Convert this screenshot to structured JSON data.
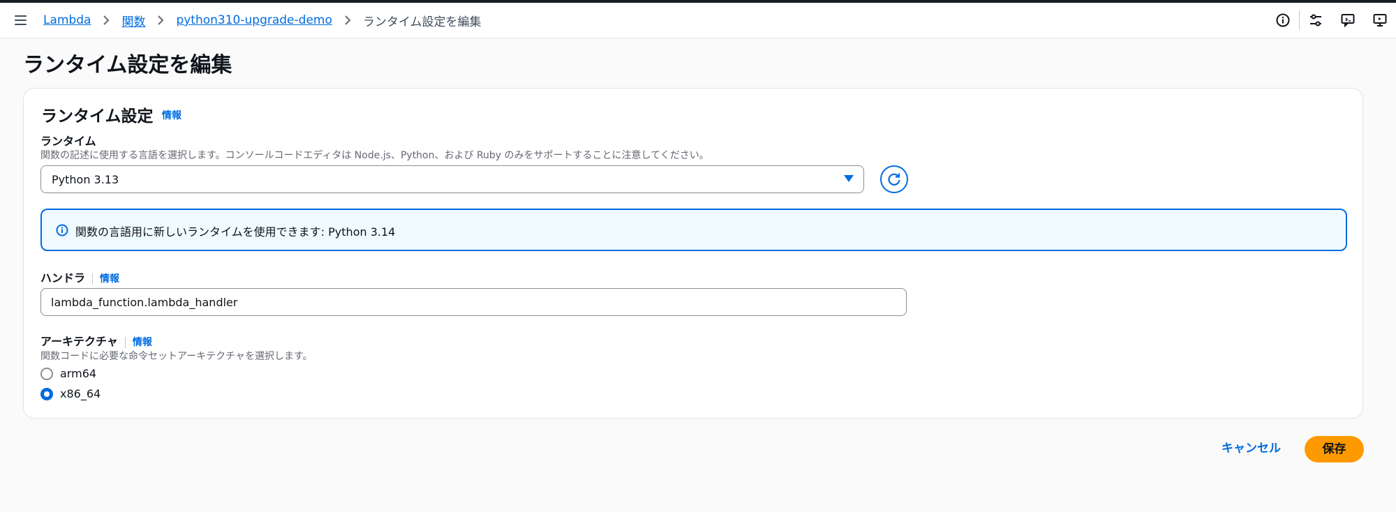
{
  "breadcrumb": {
    "items": [
      "Lambda",
      "関数",
      "python310-upgrade-demo"
    ],
    "current": "ランタイム設定を編集"
  },
  "header": {
    "icons": [
      "info-icon",
      "settings-sliders-icon",
      "feedback-icon",
      "screen-share-icon"
    ]
  },
  "page": {
    "title": "ランタイム設定を編集"
  },
  "card": {
    "title": "ランタイム設定",
    "info": "情報"
  },
  "runtime": {
    "label": "ランタイム",
    "description": "関数の記述に使用する言語を選択します。コンソールコードエディタは Node.js、Python、および Ruby のみをサポートすることに注意してください。",
    "selected": "Python 3.13"
  },
  "alert": {
    "text": "関数の言語用に新しいランタイムを使用できます: Python 3.14"
  },
  "handler": {
    "label": "ハンドラ",
    "info": "情報",
    "value": "lambda_function.lambda_handler"
  },
  "architecture": {
    "label": "アーキテクチャ",
    "info": "情報",
    "description": "関数コードに必要な命令セットアーキテクチャを選択します。",
    "options": [
      {
        "label": "arm64",
        "checked": false
      },
      {
        "label": "x86_64",
        "checked": true
      }
    ]
  },
  "actions": {
    "cancel": "キャンセル",
    "save": "保存"
  },
  "colors": {
    "accent": "#006ce0",
    "primary_button": "#ff9900",
    "alert_bg": "#f0fbff"
  }
}
